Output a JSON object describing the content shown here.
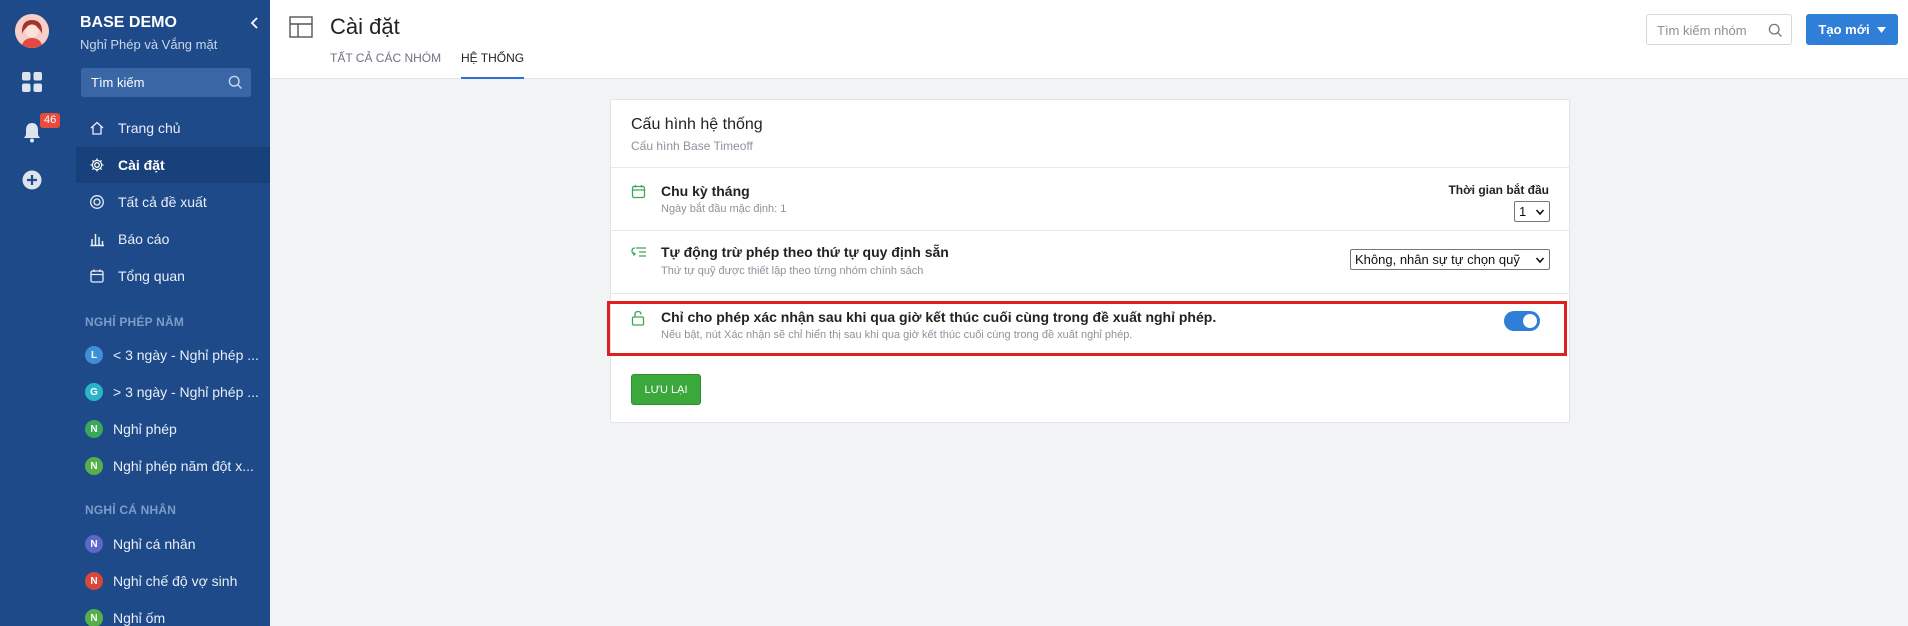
{
  "app": {
    "brand": "BASE DEMO",
    "brand_sub": "Nghỉ Phép và Vắng mặt",
    "notification_count": "46"
  },
  "sidebar": {
    "search_placeholder": "Tìm kiếm",
    "nav": [
      {
        "label": "Trang chủ",
        "icon": "home-icon"
      },
      {
        "label": "Cài đặt",
        "icon": "gear-icon",
        "active": true
      },
      {
        "label": "Tất cả đề xuất",
        "icon": "target-icon"
      },
      {
        "label": "Báo cáo",
        "icon": "bar-chart-icon"
      },
      {
        "label": "Tổng quan",
        "icon": "calendar-icon"
      }
    ],
    "section_annual": "NGHỈ PHÉP NĂM",
    "annual_groups": [
      {
        "letter": "L",
        "label": "< 3 ngày - Nghỉ phép ...",
        "color": "#3d8fd6"
      },
      {
        "letter": "G",
        "label": "> 3 ngày - Nghỉ phép ...",
        "color": "#2bb3c7"
      },
      {
        "letter": "N",
        "label": "Nghỉ phép",
        "color": "#3aa85a"
      },
      {
        "letter": "N",
        "label": "Nghỉ phép năm đột x...",
        "color": "#56b04a"
      }
    ],
    "section_personal": "NGHỈ CÁ NHÂN",
    "personal_groups": [
      {
        "letter": "N",
        "label": "Nghỉ cá nhân",
        "color": "#5b67c9"
      },
      {
        "letter": "N",
        "label": "Nghỉ chế độ vợ sinh",
        "color": "#d9463b"
      },
      {
        "letter": "N",
        "label": "Nghỉ ốm",
        "color": "#56b04a"
      }
    ]
  },
  "header": {
    "title": "Cài đặt",
    "tabs": [
      {
        "label": "TẤT CẢ CÁC NHÓM",
        "active": false
      },
      {
        "label": "HỆ THỐNG",
        "active": true
      }
    ],
    "search_placeholder": "Tìm kiếm nhóm",
    "create_label": "Tạo mới"
  },
  "settings": {
    "title": "Cấu hình hệ thống",
    "subtitle": "Cấu hình Base Timeoff",
    "rows": [
      {
        "title": "Chu kỳ tháng",
        "desc": "Ngày bắt đầu mặc định: 1",
        "control_label": "Thời gian bắt đầu",
        "control_value": "1"
      },
      {
        "title": "Tự động trừ phép theo thứ tự quy định sẵn",
        "desc": "Thứ tự quỹ được thiết lập theo từng nhóm chính sách",
        "control_value": "Không, nhân sự tự chọn quỹ"
      },
      {
        "title": "Chỉ cho phép xác nhận sau khi qua giờ kết thúc cuối cùng trong đề xuất nghỉ phép.",
        "desc": "Nếu bật, nút Xác nhận sẽ chỉ hiển thị sau khi qua giờ kết thúc cuối cùng trong đề xuất nghỉ phép.",
        "toggle_on": true
      }
    ],
    "save_label": "LƯU LẠI"
  },
  "colors": {
    "sidebar_bg": "#1e4a8a",
    "primary": "#2f7ed8",
    "save": "#3aa83a",
    "highlight": "#e02020"
  }
}
